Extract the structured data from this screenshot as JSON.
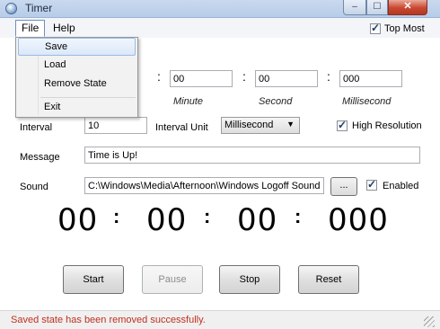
{
  "window": {
    "title": "Timer",
    "min_glyph": "–",
    "max_glyph": "☐",
    "close_glyph": "✕"
  },
  "menu": {
    "file": "File",
    "help": "Help"
  },
  "file_menu": {
    "items": [
      "Save",
      "Load",
      "Remove State",
      "Exit"
    ],
    "highlighted": "Save"
  },
  "topmost": {
    "label": "Top Most",
    "checked": true
  },
  "time_inputs": [
    {
      "value": "00",
      "unit": "Minute"
    },
    {
      "value": "00",
      "unit": "Second"
    },
    {
      "value": "000",
      "unit": "Millisecond"
    }
  ],
  "separator": ":",
  "interval": {
    "label": "Interval",
    "value": "10"
  },
  "interval_unit": {
    "label": "Interval Unit",
    "value": "Millisecond"
  },
  "high_resolution": {
    "label": "High Resolution",
    "checked": true
  },
  "message": {
    "label": "Message",
    "value": "Time is Up!"
  },
  "sound": {
    "label": "Sound",
    "value": "C:\\Windows\\Media\\Afternoon\\Windows Logoff Sound.wa",
    "browse_label": "...",
    "enabled_label": "Enabled",
    "enabled": true
  },
  "display": {
    "hours": "00",
    "minutes": "00",
    "seconds": "00",
    "milliseconds": "000"
  },
  "buttons": {
    "start": "Start",
    "pause": "Pause",
    "stop": "Stop",
    "reset": "Reset"
  },
  "status": {
    "text": "Saved state has been removed successfully.",
    "color": "#c0301f"
  },
  "icons": {
    "check": "checkmark-icon",
    "dropdown": "chevron-down-icon"
  }
}
